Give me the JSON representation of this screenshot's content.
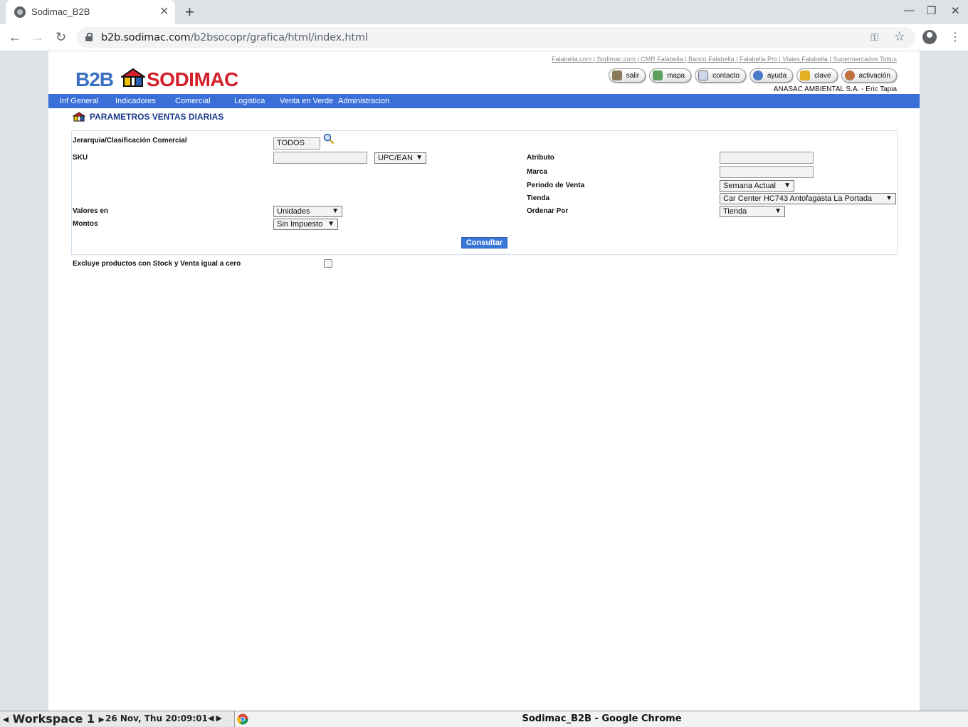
{
  "browser": {
    "tab_title": "Sodimac_B2B",
    "url_host": "b2b.sodimac.com",
    "url_path": "/b2bsocopr/grafica/html/index.html"
  },
  "header": {
    "top_links": "Falabella.com | Sodimac.com | CMR Falabella | Banco Falabella | Falabella Pro | Viajes Falabella | Supermercados Tottus",
    "logo_b2b": "B2B",
    "logo_brand": "SODIMAC",
    "buttons": [
      "salir",
      "mapa",
      "contacto",
      "ayuda",
      "clave",
      "activación"
    ],
    "user": "ANASAC AMBIENTAL S.A. - Eric Tapia"
  },
  "menu": [
    "Inf General",
    "Indicadores",
    "Comercial",
    "Logistica",
    "Venta en Verde",
    "Administracion"
  ],
  "page_title": "PARAMETROS VENTAS DIARIAS",
  "form": {
    "jerarquia_label": "Jerarquia/Clasificación Comercial",
    "jerarquia_value": "TODOS",
    "sku_label": "SKU",
    "sku_type": "UPC/EAN",
    "atributo_label": "Atributo",
    "marca_label": "Marca",
    "periodo_label": "Periodo de Venta",
    "periodo_value": "Semana Actual",
    "tienda_label": "Tienda",
    "tienda_value": "Car Center HC743 Antofagasta La Portada",
    "valores_label": "Valores en",
    "valores_value": "Unidades",
    "ordenar_label": "Ordenar Por",
    "ordenar_value": "Tienda",
    "montos_label": "Montos",
    "montos_value": "Sin Impuesto",
    "consultar": "Consultar",
    "excluye_label": "Excluye productos con Stock y Venta igual a cero"
  },
  "taskbar": {
    "workspace": "Workspace 1",
    "datetime": "26 Nov, Thu 20:09:01",
    "window_title": "Sodimac_B2B - Google Chrome"
  },
  "colors": {
    "menu_bar": "#3a6fd8",
    "brand_red": "#d4202a",
    "brand_blue": "#3a6fc2"
  }
}
